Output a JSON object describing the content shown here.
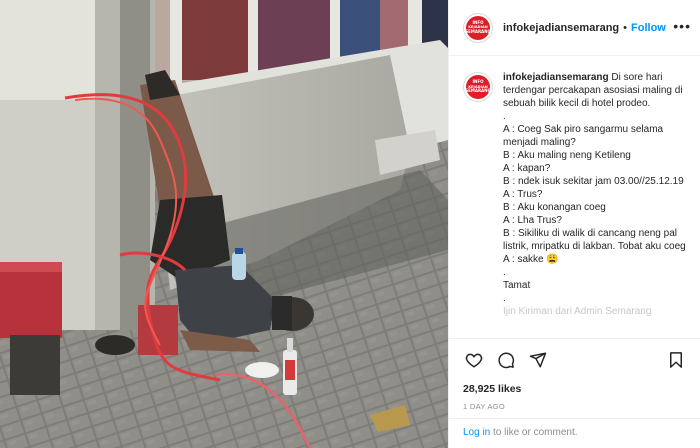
{
  "post": {
    "username": "infokejadiansemarang",
    "avatar_text": [
      "INFO",
      "KEJADIAN",
      "SEMARANG"
    ],
    "follow_label": "Follow",
    "header_separator": "•",
    "more_label": "•••"
  },
  "caption": {
    "username": "infokejadiansemarang",
    "lines": [
      "Di sore hari terdengar percakapan asosiasi maling di sebuah bilik kecil di hotel prodeo.",
      ".",
      "A : Coeg Sak piro sangarmu selama menjadi maling?",
      "B : Aku maling neng Ketileng",
      "A : kapan?",
      "B : ndek isuk sekitar jam 03.00//25.12.19",
      "A : Trus?",
      "B : Aku konangan coeg",
      "A : Lha Trus?",
      "B : Sikiliku di walik di cancang neng pal listrik, mripatku di lakban. Tobat aku coeg",
      "A : sakke 😩",
      ".",
      "Tamat",
      "."
    ],
    "cut_line": "Ijin Kiriman dari Admin Semarang"
  },
  "actions": {
    "icons": [
      "heart-icon",
      "comment-icon",
      "share-icon",
      "bookmark-icon"
    ]
  },
  "stats": {
    "likes": "28,925 likes",
    "time_ago": "1 DAY AGO"
  },
  "login": {
    "link_label": "Log in",
    "suffix": " to like or comment."
  },
  "colors": {
    "link": "#0095f6",
    "brand": "#d9202a",
    "text": "#262626",
    "muted": "#8e8e8e"
  }
}
